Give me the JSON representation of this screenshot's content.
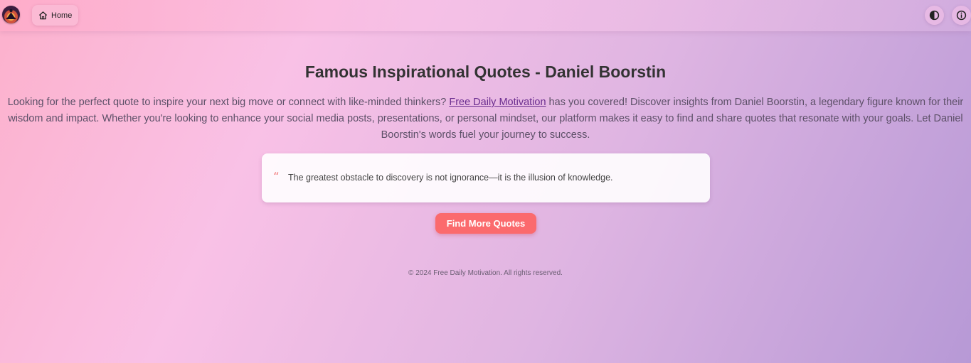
{
  "header": {
    "logo_icon": "meditating-figure-sunset-logo",
    "home_icon": "home-icon",
    "home_label": "Home",
    "contrast_icon": "contrast-half-circle-icon",
    "info_icon": "info-circle-icon"
  },
  "main": {
    "title": "Famous Inspirational Quotes - Daniel Boorstin",
    "intro_before": "Looking for the perfect quote to inspire your next big move or connect with like-minded thinkers? ",
    "intro_link": "Free Daily Motivation",
    "intro_after": " has you covered! Discover insights from Daniel Boorstin, a legendary figure known for their wisdom and impact. Whether you're looking to enhance your social media posts, presentations, or personal mindset, our platform makes it easy to find and share quotes that resonate with your goals. Let Daniel Boorstin's words fuel your journey to success.",
    "quote_mark": "“",
    "quote": "The greatest obstacle to discovery is not ignorance—it is the illusion of knowledge.",
    "cta_label": "Find More Quotes"
  },
  "footer": {
    "text": "© 2024 Free Daily Motivation. All rights reserved."
  },
  "colors": {
    "accent": "#fb6a6d",
    "link": "#6a2d8f",
    "quote_mark": "#f06a6a"
  }
}
